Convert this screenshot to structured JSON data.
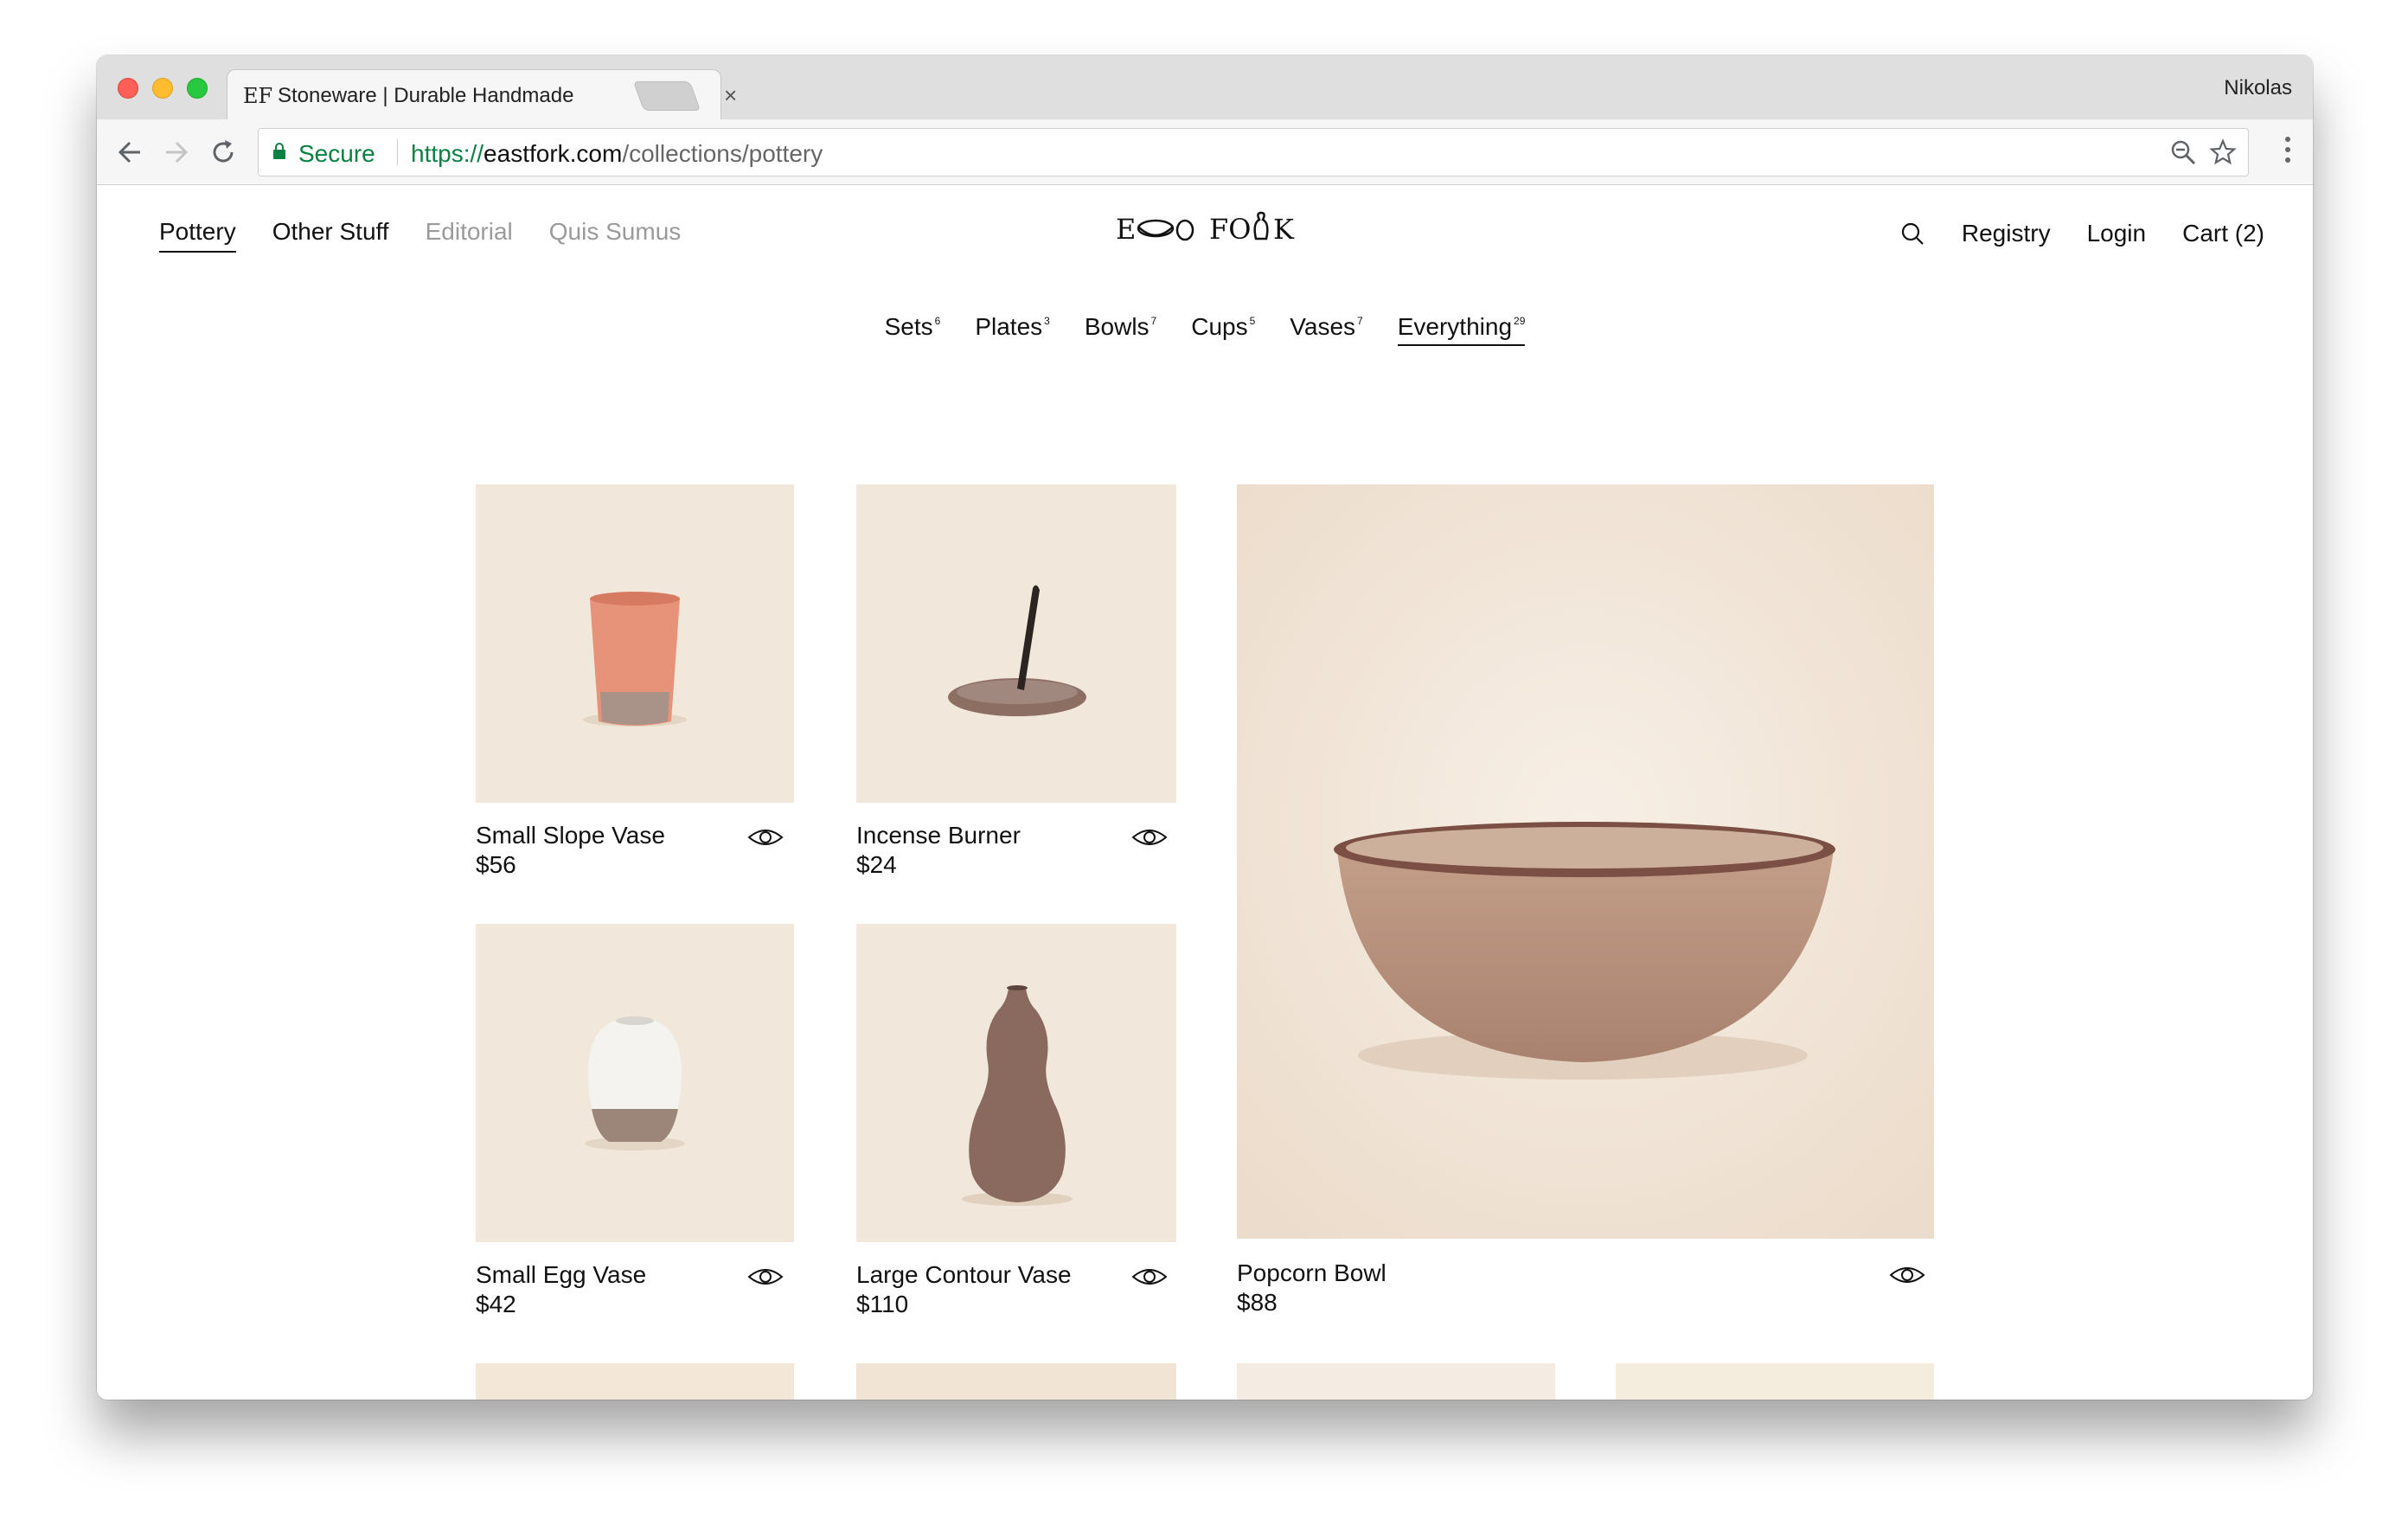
{
  "browser": {
    "tab_favicon": "EF",
    "tab_title": "Stoneware | Durable Handmade",
    "tab_close": "×",
    "profile_name": "Nikolas",
    "secure_label": "Secure",
    "url_scheme": "https://",
    "url_host": "eastfork.com",
    "url_path": "/collections/pottery",
    "icons": [
      "back-arrow-icon",
      "forward-arrow-icon",
      "reload-icon",
      "lock-icon",
      "zoom-icon",
      "star-icon",
      "menu-dots-icon"
    ]
  },
  "site": {
    "logo_text": "EAST FORK",
    "nav_left": [
      {
        "label": "Pottery",
        "active": true
      },
      {
        "label": "Other Stuff"
      },
      {
        "label": "Editorial"
      },
      {
        "label": "Quis Sumus"
      }
    ],
    "nav_right": {
      "registry": "Registry",
      "login": "Login",
      "cart": "Cart (2)"
    },
    "categories": [
      {
        "label": "Sets",
        "count": "6"
      },
      {
        "label": "Plates",
        "count": "3"
      },
      {
        "label": "Bowls",
        "count": "7"
      },
      {
        "label": "Cups",
        "count": "5"
      },
      {
        "label": "Vases",
        "count": "7"
      },
      {
        "label": "Everything",
        "count": "29",
        "active": true
      }
    ]
  },
  "products": [
    {
      "name": "Small Slope Vase",
      "price": "$56",
      "color": "#e7937a"
    },
    {
      "name": "Incense Burner",
      "price": "$24",
      "color": "#8d6e63"
    },
    {
      "name": "Small Egg Vase",
      "price": "$42",
      "color": "#f4f3f0"
    },
    {
      "name": "Large Contour Vase",
      "price": "$110",
      "color": "#8a6a5e"
    },
    {
      "name": "Popcorn Bowl",
      "price": "$88",
      "color": "#b08d78"
    }
  ],
  "colors": {
    "image_bg": "#f1e7da",
    "secure_green": "#0b8043"
  }
}
